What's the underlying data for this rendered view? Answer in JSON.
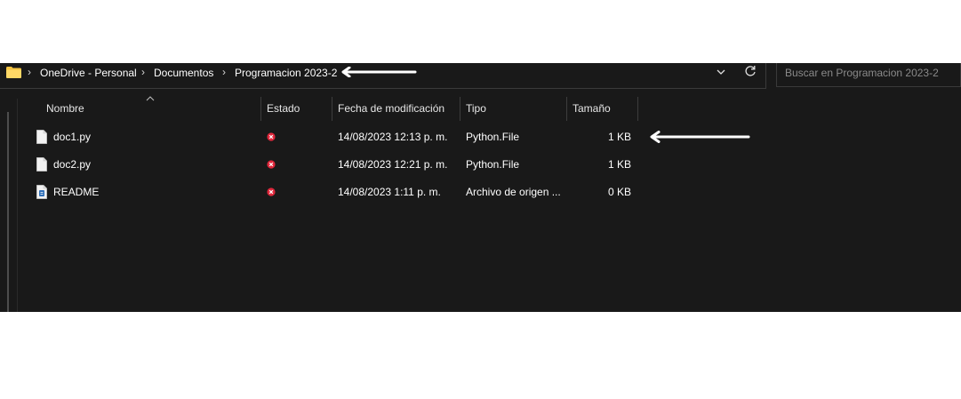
{
  "breadcrumb": {
    "items": [
      "OneDrive - Personal",
      "Documentos",
      "Programacion 2023-2"
    ]
  },
  "search": {
    "placeholder": "Buscar en Programacion 2023-2"
  },
  "columns": {
    "name": "Nombre",
    "status": "Estado",
    "modified": "Fecha de modificación",
    "type": "Tipo",
    "size": "Tamaño"
  },
  "files": [
    {
      "name": "doc1.py",
      "modified": "14/08/2023 12:13 p. m.",
      "type": "Python.File",
      "size": "1 KB",
      "icon": "python-file-icon",
      "status": "sync-error"
    },
    {
      "name": "doc2.py",
      "modified": "14/08/2023 12:21 p. m.",
      "type": "Python.File",
      "size": "1 KB",
      "icon": "python-file-icon",
      "status": "sync-error"
    },
    {
      "name": "README",
      "modified": "14/08/2023 1:11 p. m.",
      "type": "Archivo de origen ...",
      "size": "0 KB",
      "icon": "readme-file-icon",
      "status": "sync-error"
    }
  ],
  "colors": {
    "background": "#191919",
    "text": "#ffffff",
    "folder": "#f5c342",
    "status_error": "#e0283c"
  }
}
